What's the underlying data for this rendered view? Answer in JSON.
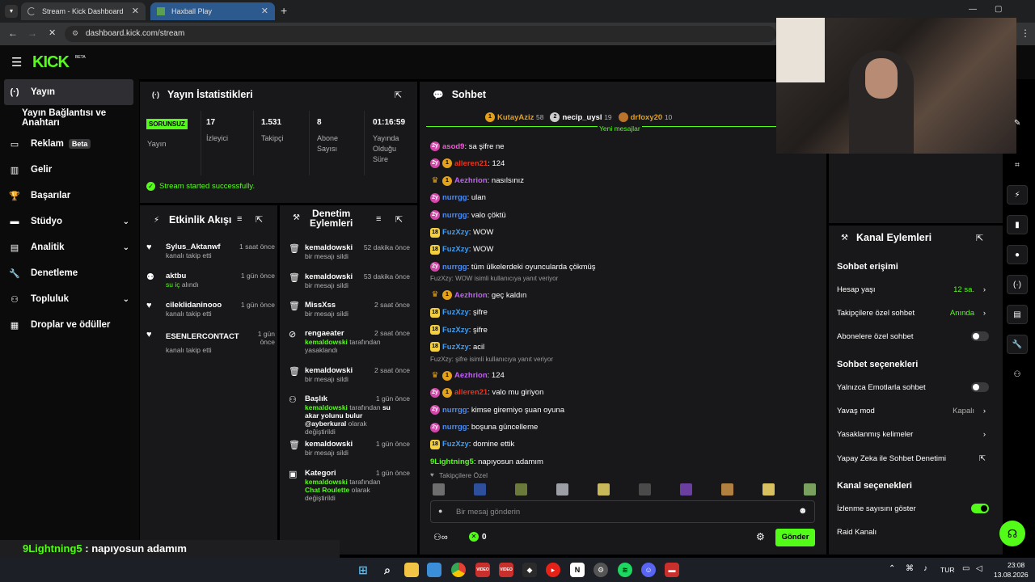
{
  "browser": {
    "tabs": [
      {
        "title": "Stream - Kick Dashboard",
        "active": true
      },
      {
        "title": "Haxball Play",
        "active": false
      }
    ],
    "url": "dashboard.kick.com/stream"
  },
  "brand": {
    "logo": "KICK",
    "logo_sup": "BETA",
    "accent": "#53fc18"
  },
  "sidebar": {
    "items": [
      {
        "label": "Yayın",
        "icon": "broadcast-icon"
      },
      {
        "label": "Yayın Bağlantısı ve Anahtarı",
        "icon": ""
      },
      {
        "label": "Reklam",
        "icon": "ad-icon",
        "badge": "Beta"
      },
      {
        "label": "Gelir",
        "icon": "revenue-icon"
      },
      {
        "label": "Başarılar",
        "icon": "trophy-icon"
      },
      {
        "label": "Stüdyo",
        "icon": "studio-icon"
      },
      {
        "label": "Analitik",
        "icon": "analytics-icon"
      },
      {
        "label": "Denetleme",
        "icon": "wrench-icon"
      },
      {
        "label": "Topluluk",
        "icon": "community-icon"
      },
      {
        "label": "Droplar ve ödüller",
        "icon": "drops-icon"
      }
    ]
  },
  "stats": {
    "title": "Yayın İstatistikleri",
    "status_badge": "SORUNSUZ",
    "status_label": "Yayın",
    "items": [
      {
        "value": "17",
        "label": "İzleyici"
      },
      {
        "value": "1.531",
        "label": "Takipçi"
      },
      {
        "value": "8",
        "label": "Abone Sayısı"
      },
      {
        "value": "01:16:59",
        "label": "Yayında Olduğu Süre"
      }
    ],
    "message": "Stream started successfully."
  },
  "activity": {
    "title": "Etkinlik Akışı",
    "items": [
      {
        "user": "Sylus_Aktanwf",
        "desc": "kanalı takip etti",
        "ago": "1 saat önce",
        "icon": "heart-icon"
      },
      {
        "user": "aktbu",
        "desc_green": "su iç",
        "desc": " alındı",
        "ago": "1 gün önce",
        "icon": "reward-icon"
      },
      {
        "user": "cileklidaninooo",
        "desc": "kanalı takip etti",
        "ago": "1 gün önce",
        "icon": "heart-icon"
      },
      {
        "user": "ESENLERCONTACT",
        "desc": "kanalı takip etti",
        "ago": "1 gün önce",
        "icon": "heart-icon"
      }
    ]
  },
  "moderation": {
    "title_1": "Denetim",
    "title_2": "Eylemleri",
    "items": [
      {
        "user": "kemaldowski",
        "desc": "bir mesajı sildi",
        "ago": "52 dakika önce",
        "icon": "trash-icon"
      },
      {
        "user": "kemaldowski",
        "desc": "bir mesajı sildi",
        "ago": "53 dakika önce",
        "icon": "trash-icon"
      },
      {
        "user": "MissXss",
        "desc": "bir mesajı sildi",
        "ago": "2 saat önce",
        "icon": "trash-icon"
      },
      {
        "user": "rengaeater",
        "desc_green": "kemaldowski",
        "desc": " tarafından yasaklandı",
        "ago": "2 saat önce",
        "icon": "ban-icon"
      },
      {
        "user": "kemaldowski",
        "desc": "bir mesajı sildi",
        "ago": "2 saat önce",
        "icon": "trash-icon"
      },
      {
        "user": "Başlık",
        "desc_green": "kemaldowski",
        "desc": " tarafından ",
        "desc_bold": "su akar yolunu bulur @ayberkural",
        "desc_tail": " olarak değiştirildi",
        "ago": "1 gün önce",
        "icon": "title-icon"
      },
      {
        "user": "kemaldowski",
        "desc": "bir mesajı sildi",
        "ago": "1 gün önce",
        "icon": "trash-icon"
      },
      {
        "user": "Kategori",
        "desc_green": "kemaldowski",
        "desc": " tarafından ",
        "desc_bold": "Chat Roulette",
        "desc_tail": " olarak değiştirildi",
        "ago": "1 gün önce",
        "icon": "category-icon"
      }
    ]
  },
  "chat": {
    "title": "Sohbet",
    "top_gifters": [
      {
        "name": "KutayAziz",
        "count": "58",
        "rank": "1"
      },
      {
        "name": "necip_uysl",
        "count": "19",
        "rank": "2"
      },
      {
        "name": "drfoxy20",
        "count": "10",
        "rank": ""
      }
    ],
    "new_messages": "Yeni mesajlar",
    "messages": [
      {
        "badges": [
          "pink"
        ],
        "user": "asod9",
        "color": "#e85cd0",
        "text": "sa şifre ne"
      },
      {
        "badges": [
          "pink",
          "gold"
        ],
        "user": "alleren21",
        "color": "#e8341c",
        "text": "124"
      },
      {
        "badges": [
          "crown",
          "gold"
        ],
        "user": "Aezhrion",
        "color": "#c062f5",
        "text": "nasılsınız"
      },
      {
        "badges": [
          "pink"
        ],
        "user": "nurrgg",
        "color": "#4a8cf5",
        "text": "ulan"
      },
      {
        "badges": [
          "pink"
        ],
        "user": "nurrgg",
        "color": "#4a8cf5",
        "text": "valo çöktü"
      },
      {
        "badges": [
          "18"
        ],
        "user": "FuzXzy",
        "color": "#3d9df5",
        "text": "WOW"
      },
      {
        "badges": [
          "18"
        ],
        "user": "FuzXzy",
        "color": "#3d9df5",
        "text": "WOW"
      },
      {
        "badges": [
          "pink"
        ],
        "user": "nurrgg",
        "color": "#4a8cf5",
        "text": "tüm ülkelerdeki oyuncularda çökmüş"
      },
      {
        "reply": "FuzXzy: WOW isimli kullanıcıya yanıt veriyor",
        "badges": [
          "crown",
          "gold"
        ],
        "user": "Aezhrion",
        "color": "#c062f5",
        "text": "geç kaldın"
      },
      {
        "badges": [
          "18"
        ],
        "user": "FuzXzy",
        "color": "#3d9df5",
        "text": "şifre"
      },
      {
        "badges": [
          "18"
        ],
        "user": "FuzXzy",
        "color": "#3d9df5",
        "text": "şifre"
      },
      {
        "badges": [
          "18"
        ],
        "user": "FuzXzy",
        "color": "#3d9df5",
        "text": "acil"
      },
      {
        "reply": "FuzXzy: şifre isimli kullanıcıya yanıt veriyor",
        "badges": [
          "crown",
          "gold"
        ],
        "user": "Aezhrion",
        "color": "#c062f5",
        "text": "124"
      },
      {
        "badges": [
          "pink",
          "gold"
        ],
        "user": "alleren21",
        "color": "#e8341c",
        "text": "valo mu giriyon"
      },
      {
        "badges": [
          "pink"
        ],
        "user": "nurrgg",
        "color": "#4a8cf5",
        "text": "kimse giremiyo şuan oyuna"
      },
      {
        "badges": [
          "pink"
        ],
        "user": "nurrgg",
        "color": "#4a8cf5",
        "text": "boşuna güncelleme"
      },
      {
        "badges": [
          "18"
        ],
        "user": "FuzXzy",
        "color": "#3d9df5",
        "text": "domine ettik"
      },
      {
        "badges": [],
        "user": "9Lightning5",
        "color": "#53fc18",
        "text": "napıyosun adamım"
      }
    ],
    "emote_label": "Takipçilere Özel",
    "input_placeholder": "Bir mesaj gönderin",
    "points": "0",
    "send_label": "Gönder"
  },
  "channel_actions": {
    "title": "Kanal Eylemleri",
    "section_access": "Sohbet erişimi",
    "account_age_label": "Hesap yaşı",
    "account_age_value": "12 sa.",
    "followers_only_label": "Takipçilere özel sohbet",
    "followers_only_value": "Anında",
    "subs_only_label": "Abonelere özel sohbet",
    "section_options": "Sohbet seçenekleri",
    "emotes_only_label": "Yalnızca Emotlarla sohbet",
    "slow_mode_label": "Yavaş mod",
    "slow_mode_value": "Kapalı",
    "banned_words_label": "Yasaklanmış kelimeler",
    "ai_mod_label": "Yapay Zeka ile Sohbet Denetimi",
    "section_channel": "Kanal seçenekleri",
    "show_views_label": "İzlenme sayısını göster",
    "raid_label": "Raid Kanalı"
  },
  "overlay_caption": {
    "user": "9Lightning5",
    "text": " : napıyosun adamım"
  },
  "taskbar": {
    "lang": "TUR",
    "time": "23:08",
    "date": "13.08.2026"
  }
}
